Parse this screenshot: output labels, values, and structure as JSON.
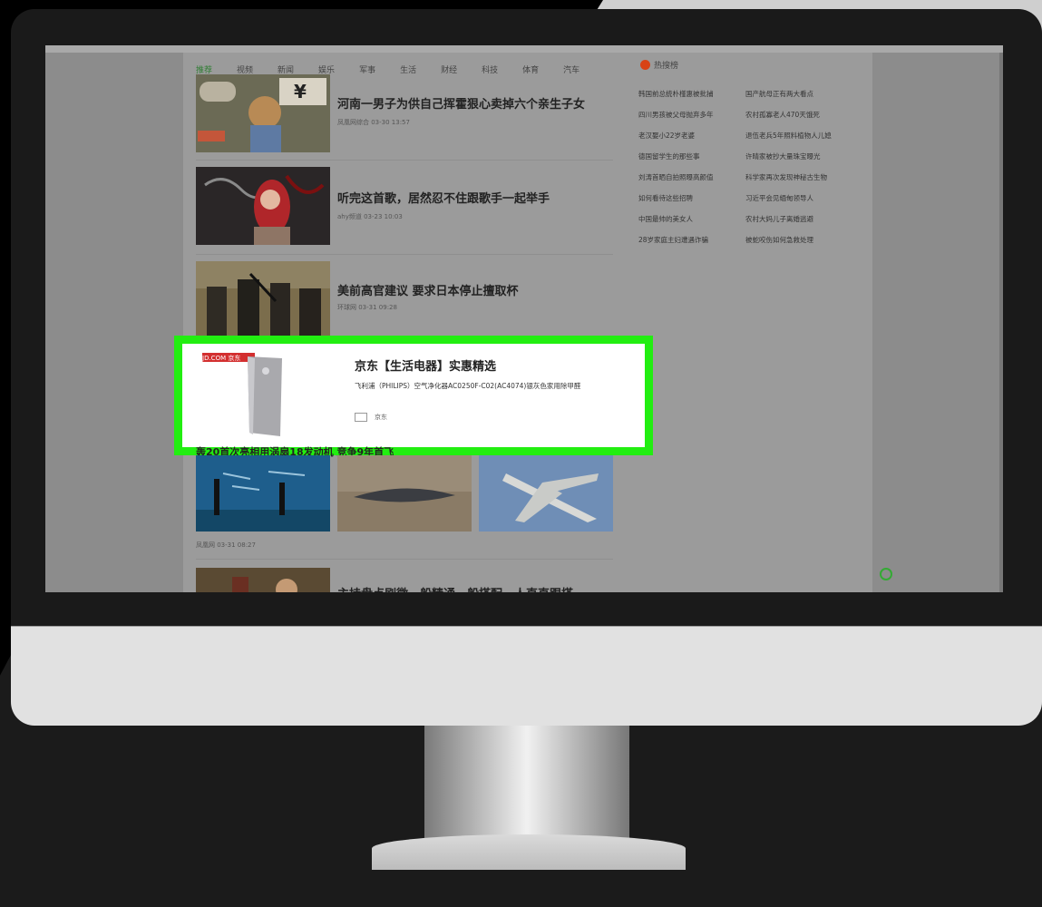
{
  "nav": {
    "tabs": [
      "推荐",
      "视频",
      "新闻",
      "娱乐",
      "军事",
      "生活",
      "财经",
      "科技",
      "体育",
      "汽车"
    ],
    "hot_label": "热搜榜"
  },
  "feed": [
    {
      "title": "河南一男子为供自己挥霍狠心卖掉六个亲生子女",
      "meta": "凤凰网综合 03-30 13:57"
    },
    {
      "title": "听完这首歌，居然忍不住跟歌手一起举手",
      "meta": "ahy频道 03-23 10:03"
    },
    {
      "title": "美前高官建议 要求日本停止擅取杯",
      "meta": "环球网 03-31 09:28"
    }
  ],
  "ad": {
    "badge": "JD.COM 京东",
    "title": "京东【生活电器】实惠精选",
    "desc": "飞利浦（PHILIPS）空气净化器AC0250F-C02(AC4074)银灰色家用除甲醛",
    "meta": "京东"
  },
  "gallery": {
    "title": "轰20首次亮相用涡扇18发动机 竞争9年首飞",
    "meta": "凤凰网 03-31 08:27"
  },
  "cut_title": "主持盘点刷微一般精通一般搭配，人直直跟搭",
  "rank": [
    [
      "韩国前总统朴槿惠被批捕",
      "国产航母正有两大看点"
    ],
    [
      "四川男孩被父母抛弃多年",
      "农村孤寡老人470天饿死"
    ],
    [
      "老汉娶小22岁老婆",
      "退伍老兵5年照料植物人儿媳"
    ],
    [
      "德国留学生的那些事",
      "许晴家被抄大量珠宝曝光"
    ],
    [
      "刘涛首晒自拍照曝高颜值",
      "科学家再次发现神秘古生物"
    ],
    [
      "如何看待这些招聘",
      "习近平会见缅甸领导人"
    ],
    [
      "中国最帅的美女人",
      "农村大妈儿子离婚逃避"
    ],
    [
      "28岁家庭主妇遭遇诈骗",
      "被蛇咬伤如何急救处理"
    ]
  ]
}
